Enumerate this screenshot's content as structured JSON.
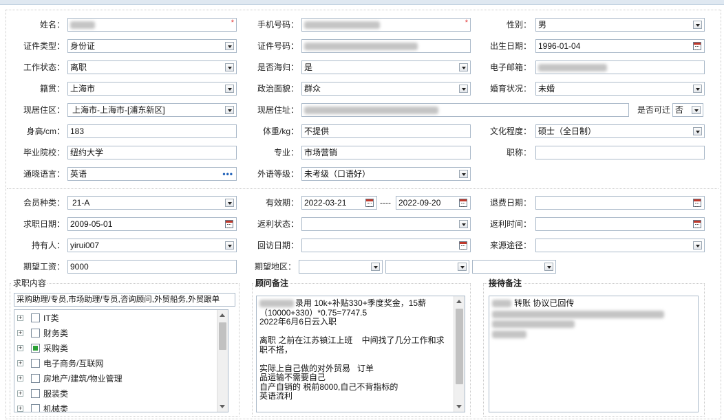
{
  "form": {
    "name_label": "姓名：",
    "phone_label": "手机号码：",
    "gender_label": "性别：",
    "gender_value": "男",
    "idtype_label": "证件类型：",
    "idtype_value": "身份证",
    "idno_label": "证件号码：",
    "birth_label": "出生日期：",
    "birth_value": "1996-01-04",
    "workstatus_label": "工作状态：",
    "workstatus_value": "离职",
    "returnee_label": "是否海归：",
    "returnee_value": "是",
    "email_label": "电子邮箱：",
    "origin_label": "籍贯：",
    "origin_value": "上海市",
    "political_label": "政治面貌：",
    "political_value": "群众",
    "marital_label": "婚育状况：",
    "marital_value": "未婚",
    "district_label": "现居住区：",
    "district_value": "上海市-上海市-[浦东新区]",
    "address_label": "现居住址：",
    "relocate_label": "是否可迁",
    "relocate_value": "否",
    "height_label": "身高/cm：",
    "height_value": "183",
    "weight_label": "体重/kg：",
    "weight_value": "不提供",
    "education_label": "文化程度：",
    "education_value": "硕士（全日制）",
    "school_label": "毕业院校：",
    "school_value": "纽约大学",
    "major_label": "专业：",
    "major_value": "市场营销",
    "title_label": "职称：",
    "language_label": "通晓语言：",
    "language_value": "英语",
    "language_level_label": "外语等级：",
    "language_level_value": "未考级（口语好）"
  },
  "member": {
    "type_label": "会员种类：",
    "type_value": "21-A",
    "validity_label": "有效期：",
    "validity_from": "2022-03-21",
    "validity_sep": "----",
    "validity_to": "2022-09-20",
    "refund_date_label": "退费日期：",
    "job_date_label": "求职日期：",
    "job_date_value": "2009-05-01",
    "rebate_status_label": "返利状态：",
    "rebate_time_label": "返利时间：",
    "holder_label": "持有人：",
    "holder_value": "yirui007",
    "visit_date_label": "回访日期：",
    "source_label": "来源途径：",
    "salary_label": "期望工资：",
    "salary_value": "9000",
    "region_label": "期望地区："
  },
  "job_content": {
    "title": "求职内容",
    "summary": "采购助理/专员,市场助理/专员,咨询顾问,外贸船务,外贸跟单",
    "categories": [
      {
        "label": "IT类",
        "checked": false
      },
      {
        "label": "财务类",
        "checked": false
      },
      {
        "label": "采购类",
        "checked": true
      },
      {
        "label": "电子商务/互联网",
        "checked": false
      },
      {
        "label": "房地产/建筑/物业管理",
        "checked": false
      },
      {
        "label": "服装类",
        "checked": false
      },
      {
        "label": "机械类",
        "checked": false
      }
    ]
  },
  "consultant_note": {
    "title": "顾问备注",
    "text": "录用 10k+补贴330+季度奖金，15薪\n（10000+330）*0.75=7747.5\n2022年6月6日云入职\n\n离职 之前在江苏镇江上班    中间找了几分工作和求职不搭，\n\n实际上自己做的对外贸易   订单\n品运输不需要自己\n自产自销的 税前8000,自己不背指标的\n英语流利"
  },
  "reception_note": {
    "title": "接待备注",
    "text": "转账 协议已回传"
  },
  "colors": {
    "required": "#e03030",
    "checked": "#2aa036",
    "border": "#a9b8c8"
  }
}
